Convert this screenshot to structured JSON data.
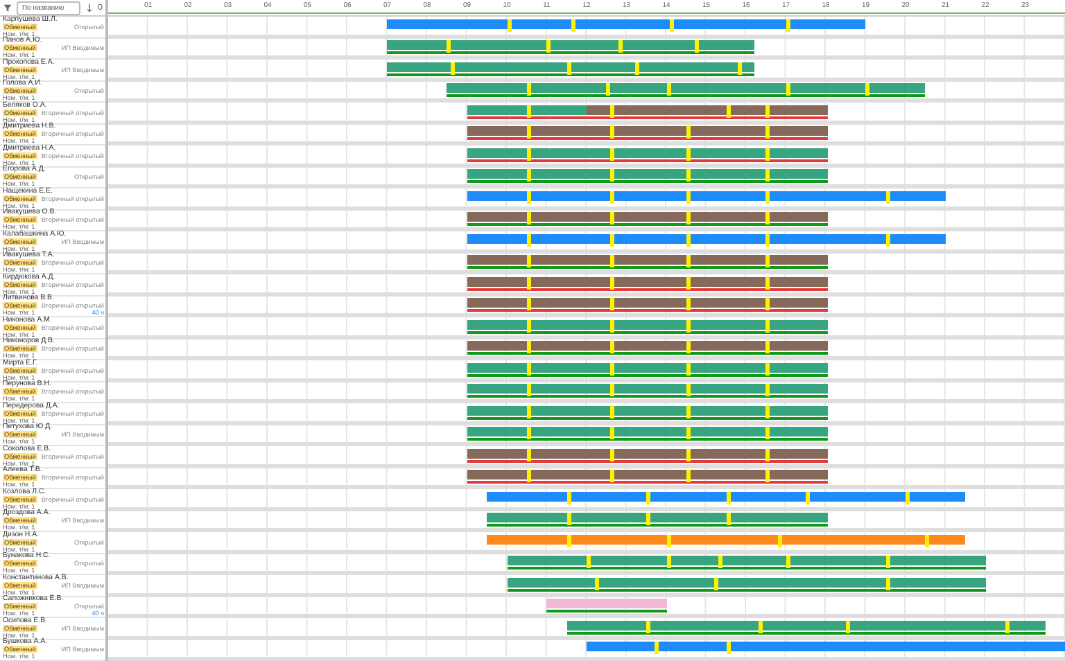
{
  "toolbar": {
    "sort_field": {
      "value": "По названию"
    },
    "count": "0"
  },
  "days": [
    "01",
    "02",
    "03",
    "04",
    "05",
    "06",
    "07",
    "08",
    "09",
    "10",
    "11",
    "12",
    "13",
    "14",
    "15",
    "16",
    "17",
    "18",
    "19",
    "20",
    "21",
    "22",
    "23"
  ],
  "rows": [
    {
      "name": "Карпушева Ш.Л.",
      "status": "Открытый",
      "badge": "Обменный",
      "note": "Ном. т/м: 1",
      "bars": [
        {
          "kind": "blue"
        }
      ]
    },
    {
      "name": "Панов А.Ю.",
      "status": "ИП Вводимым",
      "badge": "Обменный",
      "note": "Ном. т/м: 1",
      "bars": [
        {
          "kind": "green"
        }
      ],
      "progress_line": {
        "color": "#119a1a"
      }
    },
    {
      "name": "Прокопова Е.А.",
      "status": "ИП Вводимым",
      "badge": "Обменный",
      "note": "Ном. т/м: 1",
      "bars": [
        {
          "kind": "green"
        }
      ],
      "progress_line": {
        "color": "#119a1a"
      }
    },
    {
      "name": "Голова А.И.",
      "status": "Открытый",
      "badge": "Обменный",
      "note": "Ном. т/м: 1",
      "bars": [
        {
          "kind": "green"
        }
      ],
      "progress_line": {
        "color": "#119a1a"
      }
    },
    {
      "name": "Беляков О.А.",
      "status": "Вторичный открытый",
      "badge": "Обменный",
      "note": "Ном. т/м: 1",
      "bars": [
        {
          "kind": "green"
        },
        {
          "kind": "brown"
        }
      ],
      "progress_line": {
        "color": "#e53a3a"
      }
    },
    {
      "name": "Дмитриева Н.В.",
      "status": "Вторичный открытый",
      "badge": "Обменный",
      "note": "Ном. т/м: 1",
      "bars": [
        {
          "kind": "brown"
        }
      ],
      "progress_line": {
        "color": "#e53a3a"
      }
    },
    {
      "name": "Дмитриева Н.А.",
      "status": "Вторичный открытый",
      "badge": "Обменный",
      "note": "Ном. т/м: 1",
      "bars": [
        {
          "kind": "green"
        }
      ],
      "progress_line": {
        "color": "#e53a3a"
      }
    },
    {
      "name": "Егорова А.Д.",
      "status": "Открытый",
      "badge": "Обменный",
      "note": "Ном. т/м: 1",
      "bars": [
        {
          "kind": "green"
        }
      ],
      "progress_line": {
        "color": "#119a1a"
      }
    },
    {
      "name": "Нащекина Е.Е.",
      "status": "Вторичный открытый",
      "badge": "Обменный",
      "note": "Ном. т/м: 1",
      "bars": [
        {
          "kind": "blue"
        }
      ]
    },
    {
      "name": "Ивакушева О.В.",
      "status": "Вторичный открытый",
      "badge": "Обменный",
      "note": "Ном. т/м: 1",
      "bars": [
        {
          "kind": "brown"
        }
      ],
      "progress_line": {
        "color": "#119a1a"
      }
    },
    {
      "name": "Калабашкина А.Ю.",
      "status": "ИП Вводимым",
      "badge": "Обменный",
      "note": "Ном. т/м: 1",
      "bars": [
        {
          "kind": "blue"
        }
      ]
    },
    {
      "name": "Ивакушева Т.А.",
      "status": "Вторичный открытый",
      "badge": "Обменный",
      "note": "Ном. т/м: 1",
      "bars": [
        {
          "kind": "brown"
        }
      ],
      "progress_line": {
        "color": "#119a1a"
      }
    },
    {
      "name": "Кирдюкова А.Д.",
      "status": "Вторичный открытый",
      "badge": "Обменный",
      "note": "Ном. т/м: 1",
      "bars": [
        {
          "kind": "brown"
        }
      ],
      "progress_line": {
        "color": "#e53a3a"
      }
    },
    {
      "name": "Литвинова В.В.",
      "status": "Вторичный открытый",
      "badge": "Обменный",
      "note": "Ном. т/м: 1",
      "extra": "40 ч",
      "bars": [
        {
          "kind": "brown"
        }
      ],
      "progress_line": {
        "color": "#e53a3a"
      }
    },
    {
      "name": "Никонова А.М.",
      "status": "Вторичный открытый",
      "badge": "Обменный",
      "note": "Ном. т/м: 1",
      "bars": [
        {
          "kind": "green"
        }
      ],
      "progress_line": {
        "color": "#119a1a"
      }
    },
    {
      "name": "Никоноров Д.В.",
      "status": "Вторичный открытый",
      "badge": "Обменный",
      "note": "Ном. т/м: 1",
      "bars": [
        {
          "kind": "brown"
        }
      ],
      "progress_line": {
        "color": "#119a1a"
      }
    },
    {
      "name": "Мирта Е.Г.",
      "status": "Вторичный открытый",
      "badge": "Обменный",
      "note": "Ном. т/м: 1",
      "bars": [
        {
          "kind": "green"
        }
      ],
      "progress_line": {
        "color": "#119a1a"
      }
    },
    {
      "name": "Перунова В.Н.",
      "status": "Вторичный открытый",
      "badge": "Обменный",
      "note": "Ном. т/м: 1",
      "bars": [
        {
          "kind": "green"
        }
      ],
      "progress_line": {
        "color": "#119a1a"
      }
    },
    {
      "name": "Передерова Д.А.",
      "status": "Вторичный открытый",
      "badge": "Обменный",
      "note": "Ном. т/м: 1",
      "bars": [
        {
          "kind": "green"
        }
      ],
      "progress_line": {
        "color": "#119a1a"
      }
    },
    {
      "name": "Петухова Ю.Д.",
      "status": "ИП Вводимым",
      "badge": "Обменный",
      "note": "Ном. т/м: 1",
      "bars": [
        {
          "kind": "green"
        }
      ],
      "progress_line": {
        "color": "#119a1a"
      }
    },
    {
      "name": "Соколова Е.В.",
      "status": "Вторичный открытый",
      "badge": "Обменный",
      "note": "Ном. т/м: 1",
      "bars": [
        {
          "kind": "brown"
        }
      ],
      "progress_line": {
        "color": "#e53a3a"
      }
    },
    {
      "name": "Алеева Т.В.",
      "status": "Вторичный открытый",
      "badge": "Обменный",
      "note": "Ном. т/м: 1",
      "bars": [
        {
          "kind": "brown"
        }
      ],
      "progress_line": {
        "color": "#e53a3a"
      }
    },
    {
      "name": "Козлова Л.С.",
      "status": "Вторичный открытый",
      "badge": "Обменный",
      "note": "Ном. т/м: 1",
      "bars": [
        {
          "kind": "blue"
        }
      ]
    },
    {
      "name": "Дроздова А.А.",
      "status": "ИП Вводимым",
      "badge": "Обменный",
      "note": "Ном. т/м: 1",
      "bars": [
        {
          "kind": "green"
        }
      ],
      "progress_line": {
        "color": "#119a1a"
      }
    },
    {
      "name": "Дизон Н.А.",
      "status": "Открытый",
      "badge": "Обменный",
      "note": "Ном. т/м: 1",
      "bars": [
        {
          "kind": "orange"
        }
      ]
    },
    {
      "name": "Бунакова Н.С.",
      "status": "Открытый",
      "badge": "Обменный",
      "note": "Ном. т/м: 1",
      "bars": [
        {
          "kind": "green"
        }
      ],
      "progress_line": {
        "color": "#119a1a"
      }
    },
    {
      "name": "Константинова А.В.",
      "status": "ИП Вводимым",
      "badge": "Обменный",
      "note": "Ном. т/м: 1",
      "bars": [
        {
          "kind": "green"
        }
      ],
      "progress_line": {
        "color": "#119a1a"
      }
    },
    {
      "name": "Сапожникова Е.В.",
      "status": "Открытый",
      "badge": "Обменный",
      "note": "Ном. т/м: 1",
      "extra": "40 ч",
      "bars": [
        {
          "kind": "pink"
        }
      ],
      "progress_line": {
        "color": "#119a1a"
      }
    },
    {
      "name": "Осипова Е.В.",
      "status": "ИП Вводимым",
      "badge": "Обменный",
      "note": "Ном. т/м: 1",
      "bars": [
        {
          "kind": "green"
        }
      ],
      "progress_line": {
        "color": "#119a1a"
      }
    },
    {
      "name": "Бушкова А.А.",
      "status": "ИП Вводимым",
      "badge": "Обменный",
      "note": "Ном. т/м: 1",
      "bars": [
        {
          "kind": "blue"
        }
      ]
    }
  ]
}
